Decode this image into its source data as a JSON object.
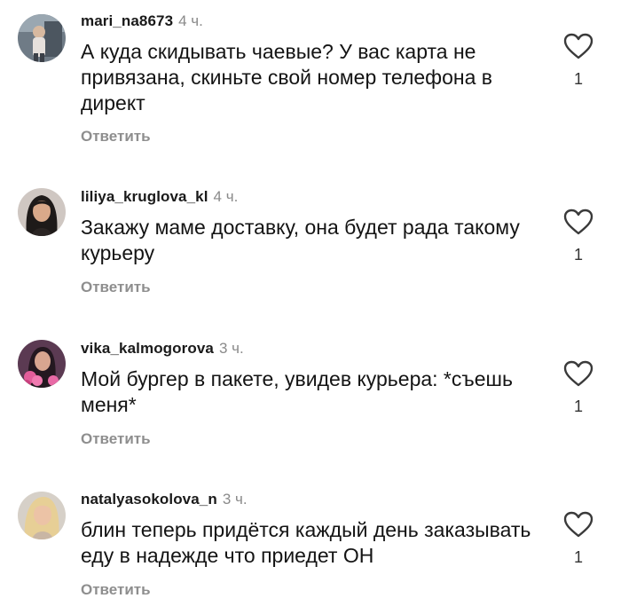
{
  "comments": [
    {
      "username": "mari_na8673",
      "time": "4 ч.",
      "text": "А куда скидывать чаевые? У вас карта не привязана, скиньте свой номер телефона в директ",
      "reply_label": "Ответить",
      "likes": "1",
      "avatar": "avatar-photo-woman-standing"
    },
    {
      "username": "liliya_kruglova_kl",
      "time": "4 ч.",
      "text": "Закажу маме доставку, она будет рада такому курьеру",
      "reply_label": "Ответить",
      "likes": "1",
      "avatar": "avatar-photo-woman-dark-hair"
    },
    {
      "username": "vika_kalmogorova",
      "time": "3 ч.",
      "text": "Мой бургер в пакете, увидев курьера: *съешь меня*",
      "reply_label": "Ответить",
      "likes": "1",
      "avatar": "avatar-photo-woman-flowers"
    },
    {
      "username": "natalyasokolova_n",
      "time": "3 ч.",
      "text": "блин теперь придётся каждый день заказывать еду в надежде что приедет ОН",
      "reply_label": "Ответить",
      "likes": "1",
      "avatar": "avatar-photo-woman-blonde"
    }
  ],
  "icons": {
    "like": "heart-outline-icon"
  },
  "colors": {
    "username": "#1a1a1a",
    "timestamp": "#8a8a8a",
    "reply": "#8e8e8e",
    "text": "#141414"
  }
}
